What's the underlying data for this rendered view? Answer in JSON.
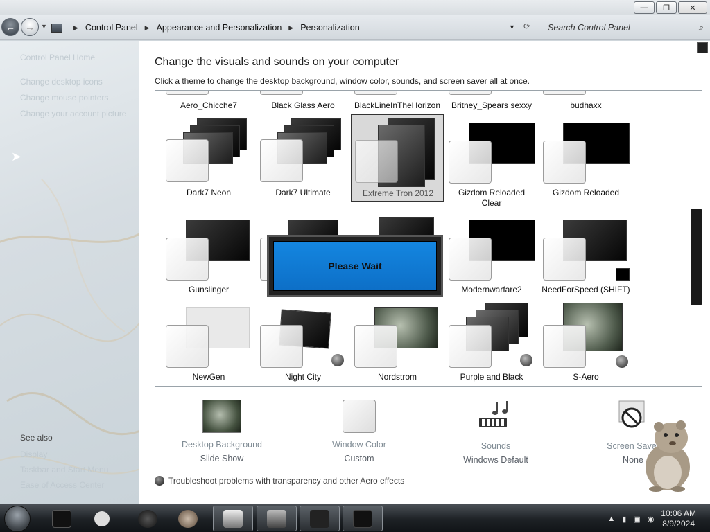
{
  "window": {
    "minimize_glyph": "—",
    "maximize_glyph": "❐",
    "close_glyph": "✕"
  },
  "address": {
    "breadcrumbs": [
      "Control Panel",
      "Appearance and Personalization",
      "Personalization"
    ],
    "search_placeholder": "Search Control Panel"
  },
  "sidebar": {
    "links": [
      "Control Panel Home",
      "Change desktop icons",
      "Change mouse pointers",
      "Change your account picture"
    ],
    "see_also": "See also",
    "see_also_links": [
      "Display",
      "Taskbar and Start Menu",
      "Ease of Access Center"
    ]
  },
  "main": {
    "title": "Change the visuals and sounds on your computer",
    "subtitle": "Click a theme to change the desktop background, window color, sounds, and screen saver all at once.",
    "top_row": [
      "Aero_Chicche7",
      "Black Glass Aero",
      "BlackLineInTheHorizon",
      "Britney_Spears sexxy",
      "budhaxx"
    ],
    "themes": [
      {
        "name": "Dark7 Neon",
        "line2": ""
      },
      {
        "name": "Dark7 Ultimate",
        "line2": ""
      },
      {
        "name": "Extreme Tron 2012",
        "line2": ""
      },
      {
        "name": "Gizdom Reloaded",
        "line2": "Clear"
      },
      {
        "name": "Gizdom Reloaded",
        "line2": ""
      },
      {
        "name": "Gunslinger",
        "line2": ""
      },
      {
        "name": "",
        "line2": ""
      },
      {
        "name": "",
        "line2": ""
      },
      {
        "name": "Modernwarfare2",
        "line2": ""
      },
      {
        "name": "NeedForSpeed (SHIFT)",
        "line2": ""
      },
      {
        "name": "NewGen",
        "line2": ""
      },
      {
        "name": "Night City",
        "line2": ""
      },
      {
        "name": "Nordstrom",
        "line2": ""
      },
      {
        "name": "Purple and Black",
        "line2": ""
      },
      {
        "name": "S-Aero",
        "line2": ""
      }
    ],
    "please_wait": "Please Wait",
    "options": [
      {
        "label": "Desktop Background",
        "value": "Slide Show"
      },
      {
        "label": "Window Color",
        "value": "Custom"
      },
      {
        "label": "Sounds",
        "value": "Windows Default"
      },
      {
        "label": "Screen Saver",
        "value": "None"
      }
    ],
    "troubleshoot": "Troubleshoot problems with transparency and other Aero effects"
  },
  "taskbar": {
    "time": "10:06 AM",
    "date": "8/9/2024"
  }
}
